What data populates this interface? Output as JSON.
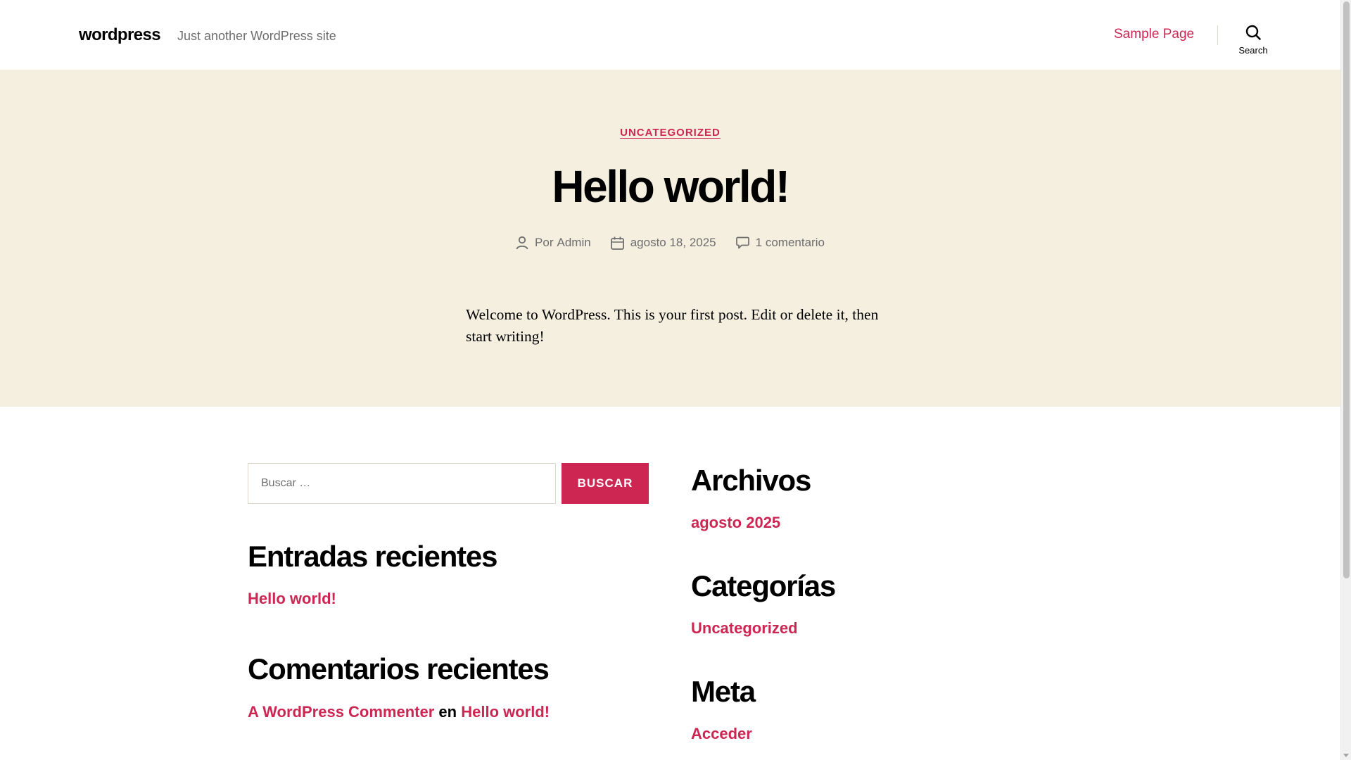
{
  "header": {
    "site_title": "wordpress",
    "site_description": "Just another WordPress site",
    "nav_items": [
      "Sample Page"
    ],
    "search_label": "Search"
  },
  "hero": {
    "category": "UNCATEGORIZED",
    "title": "Hello world!",
    "meta": {
      "author_prefix": "Por",
      "author": "Admin",
      "date": "agosto 18, 2025",
      "comments": "1 comentario"
    },
    "content": "Welcome to WordPress. This is your first post. Edit or delete it, then start writing!"
  },
  "widgets": {
    "search": {
      "placeholder": "Buscar …",
      "button_label": "BUSCAR"
    },
    "recent_posts": {
      "title": "Entradas recientes",
      "items": [
        "Hello world!"
      ]
    },
    "recent_comments": {
      "title": "Comentarios recientes",
      "items": [
        {
          "author": "A WordPress Commenter",
          "connector": "en",
          "post": "Hello world!"
        }
      ]
    },
    "archives": {
      "title": "Archivos",
      "items": [
        "agosto 2025"
      ]
    },
    "categories": {
      "title": "Categorías",
      "items": [
        "Uncategorized"
      ]
    },
    "meta": {
      "title": "Meta",
      "items": [
        "Acceder"
      ]
    }
  },
  "colors": {
    "accent": "#cd2653",
    "hero_background": "#f5efe0",
    "muted_text": "#6d6d6d",
    "border": "#dcd7ca"
  },
  "icons": {
    "search": "search-icon",
    "author": "person-icon",
    "date": "calendar-icon",
    "comments": "comment-icon"
  }
}
